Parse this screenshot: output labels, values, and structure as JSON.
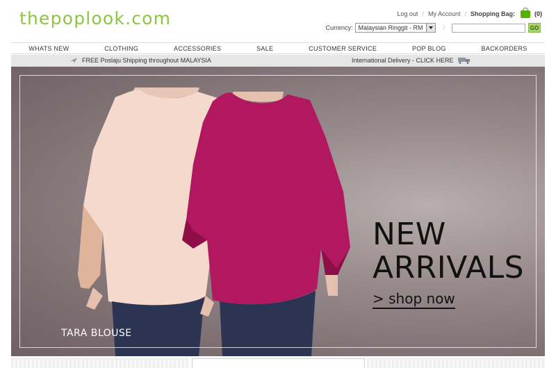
{
  "brand": {
    "logo_text": "thepoplook.com",
    "accent_color": "#8cc63f"
  },
  "account": {
    "logout": "Log out",
    "my_account": "My Account",
    "shopping_bag_label": "Shopping Bag:",
    "bag_count": "(0)",
    "separator": "/"
  },
  "currency": {
    "label": "Currency:",
    "selected": "Malaysian Ringgit - RM"
  },
  "search": {
    "value": "",
    "go_label": "GO"
  },
  "nav": {
    "items": [
      "WHATS NEW",
      "CLOTHING",
      "ACCESSORIES",
      "SALE",
      "CUSTOMER SERVICE",
      "POP BLOG",
      "BACKORDERS"
    ]
  },
  "shipping": {
    "left_text": "FREE Poslaju Shipping throughout MALAYSIA",
    "right_text": "International Delivery - CLICK HERE",
    "left_icon": "plane-icon",
    "right_icon": "truck-icon"
  },
  "banner": {
    "headline_line1": "NEW",
    "headline_line2": "ARRIVALS",
    "cta": "> shop now",
    "product_name": "TARA BLOUSE",
    "colors": {
      "blouse_light": "#f4d9cc",
      "blouse_magenta": "#b2185f",
      "jeans": "#2b3452"
    }
  }
}
